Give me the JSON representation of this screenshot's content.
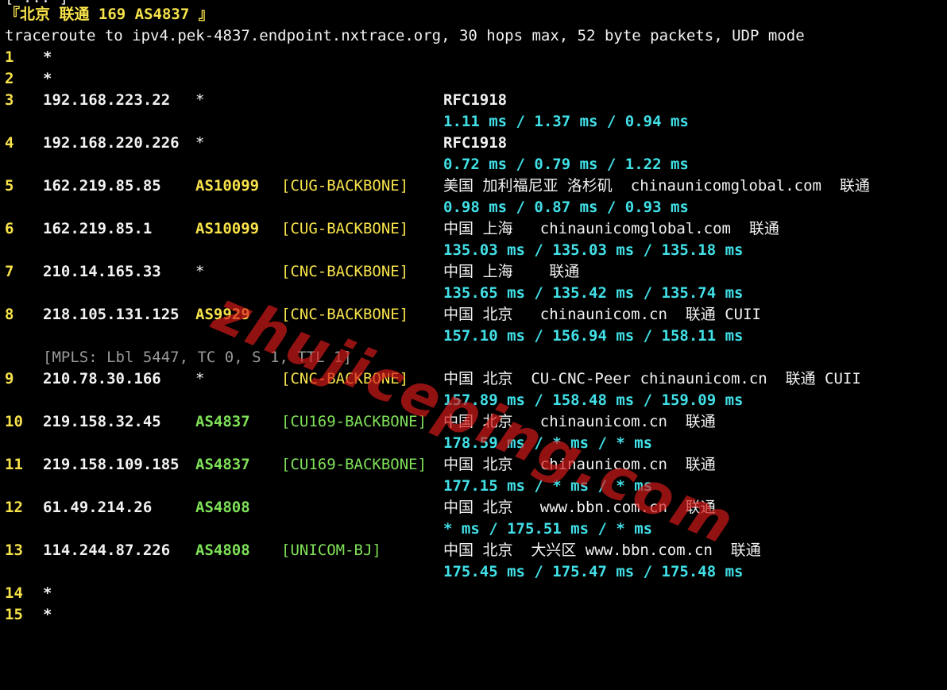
{
  "top_fragment": "[ ... ]",
  "section_title": "『北京 联通 169 AS4837 』",
  "trace_header": "traceroute to ipv4.pek-4837.endpoint.nxtrace.org, 30 hops max, 52 byte packets, UDP mode",
  "hops": [
    {
      "hop": "1",
      "ip": "*"
    },
    {
      "hop": "2",
      "ip": "*"
    },
    {
      "hop": "3",
      "ip": "192.168.223.22",
      "asn": "*",
      "geo": "RFC1918",
      "rtt": "1.11 ms / 1.37 ms / 0.94 ms"
    },
    {
      "hop": "4",
      "ip": "192.168.220.226",
      "asn": "*",
      "geo": "RFC1918",
      "rtt": "0.72 ms / 0.79 ms / 1.22 ms"
    },
    {
      "hop": "5",
      "ip": "162.219.85.85",
      "asn": "AS10099",
      "tag": "[CUG-BACKBONE]",
      "geo": "美国 加利福尼亚 洛杉矶  chinaunicomglobal.com  联通",
      "rtt": "0.98 ms / 0.87 ms / 0.93 ms"
    },
    {
      "hop": "6",
      "ip": "162.219.85.1",
      "asn": "AS10099",
      "tag": "[CUG-BACKBONE]",
      "geo": "中国 上海   chinaunicomglobal.com  联通",
      "rtt": "135.03 ms / 135.03 ms / 135.18 ms"
    },
    {
      "hop": "7",
      "ip": "210.14.165.33",
      "asn": "*",
      "tag": "[CNC-BACKBONE]",
      "geo": "中国 上海    联通",
      "rtt": "135.65 ms / 135.42 ms / 135.74 ms"
    },
    {
      "hop": "8",
      "ip": "218.105.131.125",
      "asn": "AS9929",
      "tag": "[CNC-BACKBONE]",
      "geo": "中国 北京   chinaunicom.cn  联通 CUII",
      "rtt": "157.10 ms / 156.94 ms / 158.11 ms",
      "mpls": "[MPLS: Lbl 5447, TC 0, S 1, TTL 1]"
    },
    {
      "hop": "9",
      "ip": "210.78.30.166",
      "asn": "*",
      "tag": "[CNC-BACKBONE]",
      "geo": "中国 北京  CU-CNC-Peer chinaunicom.cn  联通 CUII",
      "rtt": "157.89 ms / 158.48 ms / 159.09 ms"
    },
    {
      "hop": "10",
      "ip": "219.158.32.45",
      "asn": "AS4837",
      "tag": "[CU169-BACKBONE]",
      "geo": "中国 北京   chinaunicom.cn  联通",
      "rtt": "178.59 ms / * ms / * ms"
    },
    {
      "hop": "11",
      "ip": "219.158.109.185",
      "asn": "AS4837",
      "tag": "[CU169-BACKBONE]",
      "geo": "中国 北京   chinaunicom.cn  联通",
      "rtt": "177.15 ms / * ms / * ms"
    },
    {
      "hop": "12",
      "ip": "61.49.214.26",
      "asn": "AS4808",
      "geo": "中国 北京   www.bbn.com.cn  联通",
      "rtt": "* ms / 175.51 ms / * ms"
    },
    {
      "hop": "13",
      "ip": "114.244.87.226",
      "asn": "AS4808",
      "tag": "[UNICOM-BJ]",
      "geo": "中国 北京  大兴区 www.bbn.com.cn  联通",
      "rtt": "175.45 ms / 175.47 ms / 175.48 ms"
    },
    {
      "hop": "14",
      "ip": "*"
    },
    {
      "hop": "15",
      "ip": "*"
    }
  ],
  "watermark": "zhujiceping.com",
  "colors": {
    "background": "#000000",
    "hop_number": "#f7e24a",
    "asn_cug_cnc": "#f7e24a",
    "asn_cu169": "#7ee157",
    "rtt": "#41e0e7",
    "text": "#f2f2f2",
    "mpls": "#9a9a9a",
    "watermark": "#d81b1b"
  }
}
